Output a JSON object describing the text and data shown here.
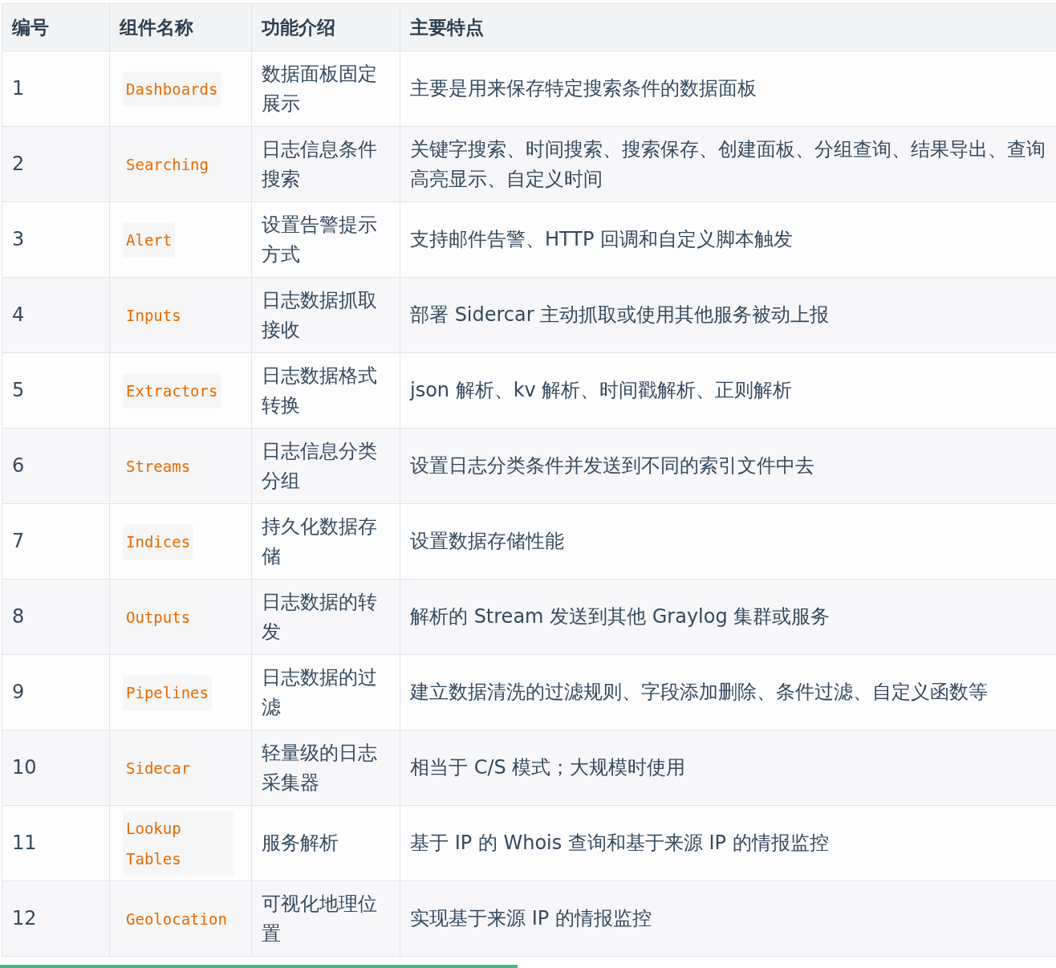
{
  "table": {
    "columns": [
      "编号",
      "组件名称",
      "功能介绍",
      "主要特点"
    ],
    "rows": [
      {
        "number": "1",
        "component": "Dashboards",
        "function": "数据面板固定展示",
        "features": "主要是用来保存特定搜索条件的数据面板"
      },
      {
        "number": "2",
        "component": "Searching",
        "function": "日志信息条件搜索",
        "features": "关键字搜索、时间搜索、搜索保存、创建面板、分组查询、结果导出、查询高亮显示、自定义时间"
      },
      {
        "number": "3",
        "component": "Alert",
        "function": "设置告警提示方式",
        "features": "支持邮件告警、HTTP 回调和自定义脚本触发"
      },
      {
        "number": "4",
        "component": "Inputs",
        "function": "日志数据抓取接收",
        "features": "部署 Sidercar 主动抓取或使用其他服务被动上报"
      },
      {
        "number": "5",
        "component": "Extractors",
        "function": "日志数据格式转换",
        "features": "json 解析、kv 解析、时间戳解析、正则解析"
      },
      {
        "number": "6",
        "component": "Streams",
        "function": "日志信息分类分组",
        "features": "设置日志分类条件并发送到不同的索引文件中去"
      },
      {
        "number": "7",
        "component": "Indices",
        "function": "持久化数据存储",
        "features": "设置数据存储性能"
      },
      {
        "number": "8",
        "component": "Outputs",
        "function": "日志数据的转发",
        "features": "解析的 Stream 发送到其他 Graylog 集群或服务"
      },
      {
        "number": "9",
        "component": "Pipelines",
        "function": "日志数据的过滤",
        "features": "建立数据清洗的过滤规则、字段添加删除、条件过滤、自定义函数等"
      },
      {
        "number": "10",
        "component": "Sidecar",
        "function": "轻量级的日志采集器",
        "features": "相当于 C/S 模式；大规模时使用"
      },
      {
        "number": "11",
        "component": "Lookup Tables",
        "function": "服务解析",
        "features": "基于 IP 的 Whois 查询和基于来源 IP 的情报监控"
      },
      {
        "number": "12",
        "component": "Geolocation",
        "function": "可视化地理位置",
        "features": "实现基于来源 IP 的情报监控"
      }
    ]
  },
  "reading_progress": {
    "level": 0.49
  }
}
